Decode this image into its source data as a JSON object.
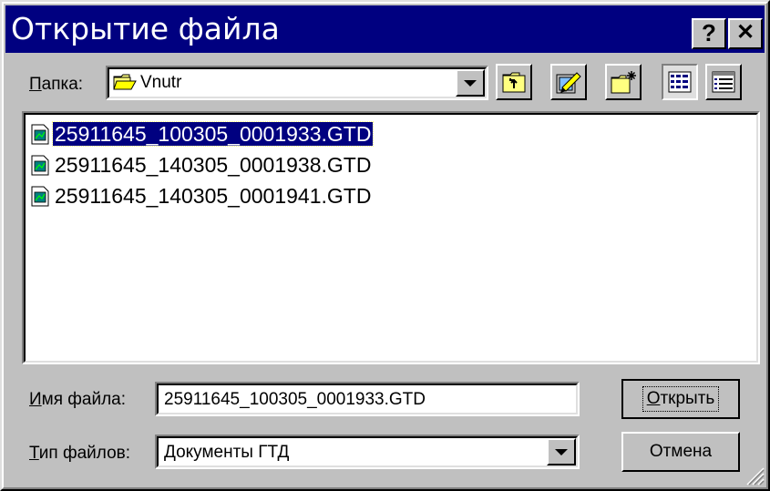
{
  "window": {
    "title": "Открытие файла",
    "help_label": "?",
    "close_label": "✕"
  },
  "folder": {
    "label_underlined": "П",
    "label_rest": "апка:",
    "current": "Vnutr",
    "icon": "folder-icon"
  },
  "toolbar": {
    "up_icon": "up-one-level-icon",
    "desktop_icon": "desktop-icon",
    "new_folder_icon": "new-folder-icon",
    "list_view_icon": "list-view-icon",
    "details_view_icon": "details-view-icon"
  },
  "files": [
    {
      "name": "25911645_100305_0001933.GTD",
      "selected": true
    },
    {
      "name": "25911645_140305_0001938.GTD",
      "selected": false
    },
    {
      "name": "25911645_140305_0001941.GTD",
      "selected": false
    }
  ],
  "filename": {
    "label_underlined": "И",
    "label_rest": "мя файла:",
    "value": "25911645_100305_0001933.GTD"
  },
  "filetype": {
    "label_underlined": "Т",
    "label_rest": "ип файлов:",
    "value": "Документы ГТД"
  },
  "buttons": {
    "open_underlined": "О",
    "open_rest": "ткрыть",
    "cancel": "Отмена"
  },
  "colors": {
    "titlebar": "#000080",
    "face": "#c0c0c0",
    "selection": "#000080"
  }
}
